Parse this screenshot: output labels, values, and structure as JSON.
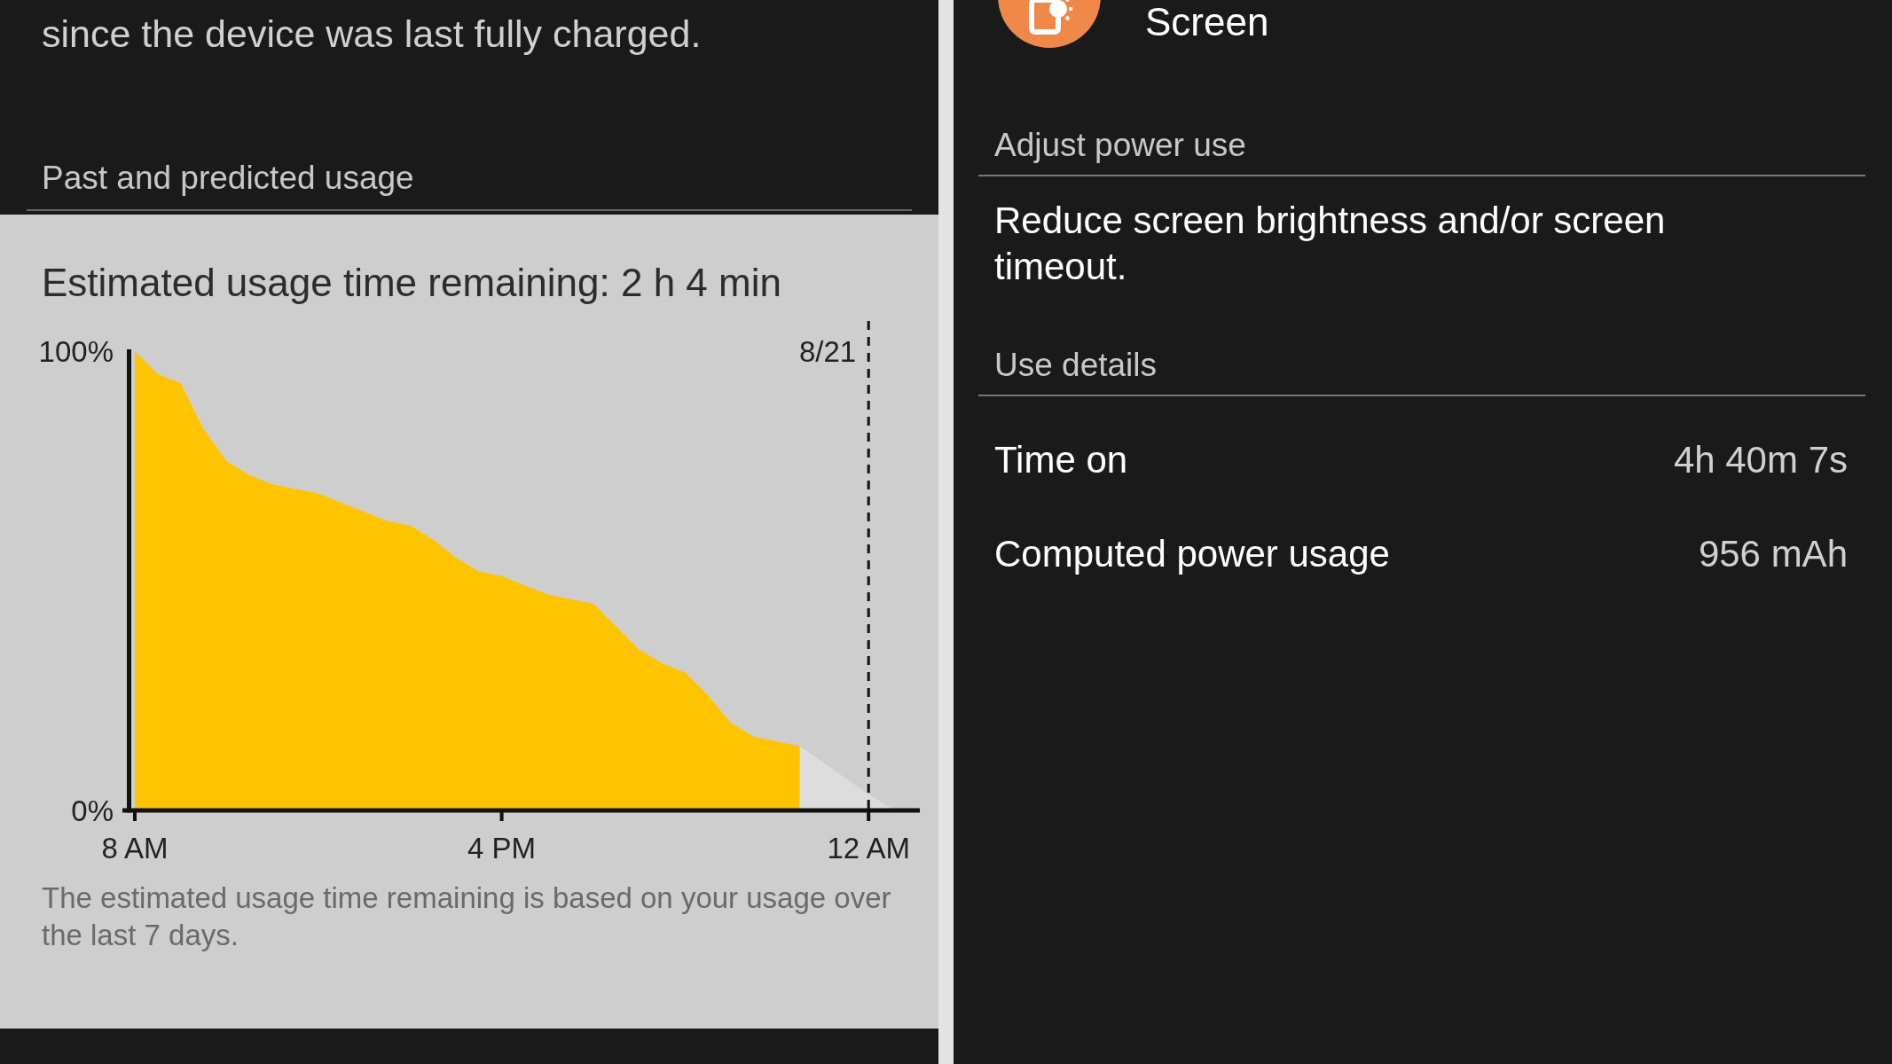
{
  "left_panel": {
    "intro_text": "since the device was last fully charged.",
    "section_header": "Past and predicted usage",
    "usage_card": {
      "title": "Estimated usage time remaining: 2 h 4 min",
      "chart_data": {
        "type": "area",
        "categories": [
          "8 AM",
          null,
          null,
          null,
          null,
          null,
          null,
          null,
          null,
          null,
          null,
          null,
          null,
          null,
          null,
          null,
          "4 PM",
          null,
          null,
          null,
          null,
          null,
          null,
          null,
          null,
          null,
          null,
          null,
          null,
          null,
          null,
          null,
          "12 AM",
          null
        ],
        "series": [
          {
            "color": "#ffc400",
            "values": [
              100,
              95,
              93,
              83,
              76,
              73,
              71,
              70,
              69,
              67,
              65,
              63,
              62,
              59,
              55,
              52,
              51,
              49,
              47,
              46,
              45,
              40,
              35,
              32,
              30,
              25,
              19,
              16,
              15,
              14,
              null,
              null,
              null,
              null
            ]
          },
          {
            "color": "#dddddd",
            "values": [
              null,
              null,
              null,
              null,
              null,
              null,
              null,
              null,
              null,
              null,
              null,
              null,
              null,
              null,
              null,
              null,
              null,
              null,
              null,
              null,
              null,
              null,
              null,
              null,
              null,
              null,
              null,
              null,
              null,
              14,
              10.5,
              7,
              3.5,
              0.5
            ]
          }
        ],
        "ylim": [
          0,
          100
        ],
        "yticks": [
          {
            "value": 0,
            "label": "0%"
          },
          {
            "value": 100,
            "label": "100%"
          }
        ]
      },
      "date_marker": "8/21",
      "footnote": "The estimated usage time remaining is based on your usage over the last 7 days."
    }
  },
  "right_panel": {
    "app_title": "Screen",
    "sections": [
      {
        "header": "Adjust power use",
        "kind": "text",
        "text": "Reduce screen brightness and/or screen timeout."
      },
      {
        "header": "Use details",
        "kind": "rows",
        "rows": [
          {
            "label": "Time on",
            "value": "4h 40m 7s"
          },
          {
            "label": "Computed power usage",
            "value": "956 mAh"
          }
        ]
      }
    ]
  }
}
